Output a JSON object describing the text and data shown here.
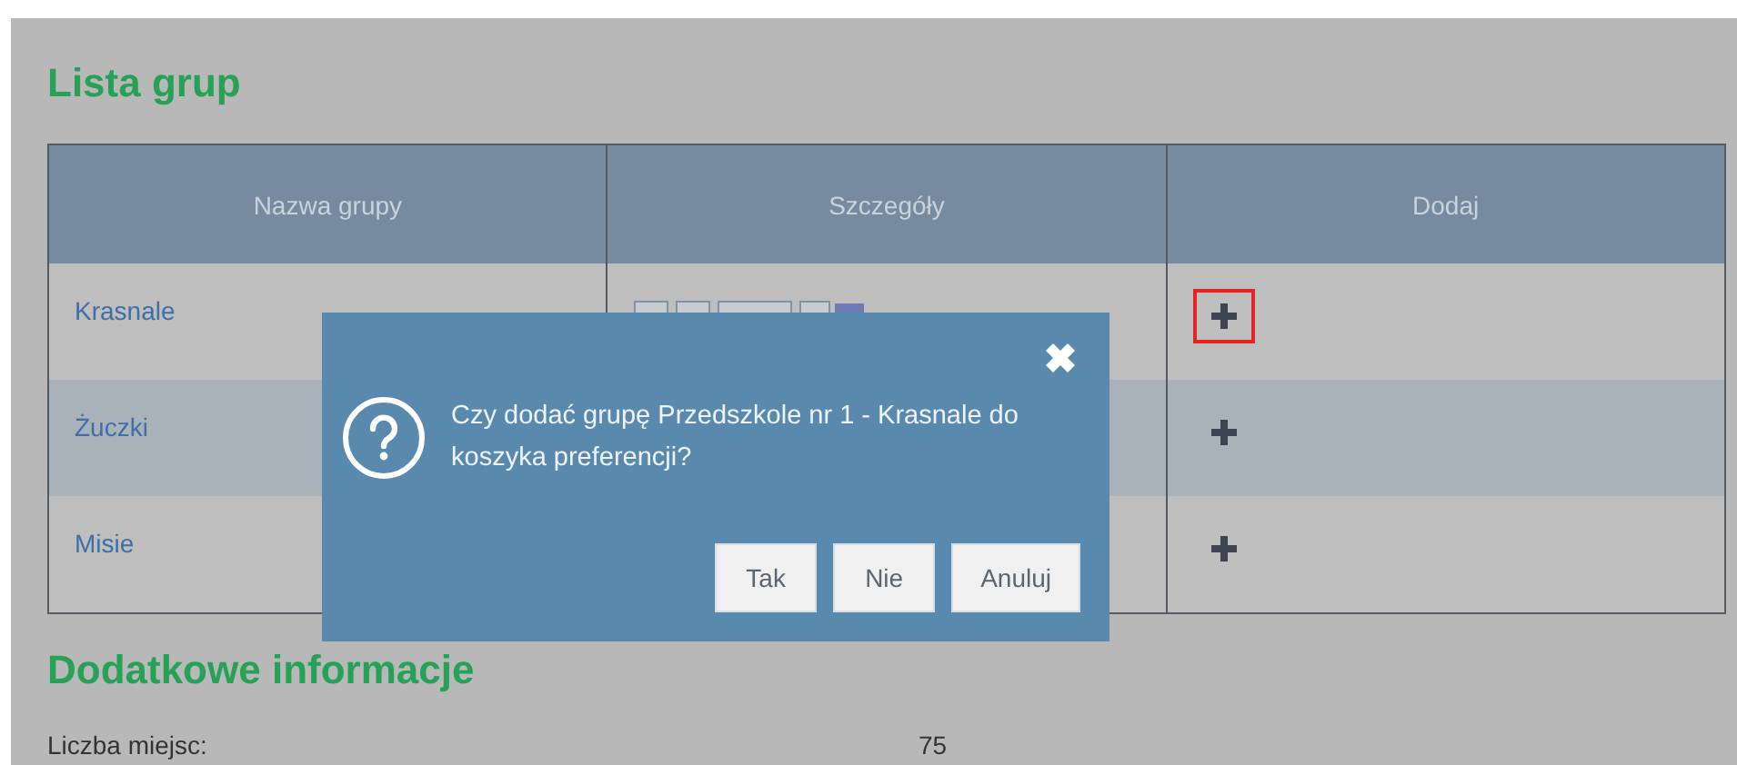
{
  "list_title": "Lista grup",
  "table": {
    "columns": [
      "Nazwa grupy",
      "Szczegóły",
      "Dodaj"
    ],
    "rows": [
      {
        "name": "Krasnale",
        "highlighted": true
      },
      {
        "name": "Żuczki",
        "highlighted": false
      },
      {
        "name": "Misie",
        "highlighted": false
      }
    ]
  },
  "dialog": {
    "message": "Czy dodać grupę Przedszkole nr 1 - Krasnale do koszyka preferencji?",
    "buttons": [
      "Tak",
      "Nie",
      "Anuluj"
    ]
  },
  "additional_info": {
    "title": "Dodatkowe informacje",
    "fields": [
      {
        "label": "Liczba miejsc:",
        "value": "75"
      }
    ]
  }
}
